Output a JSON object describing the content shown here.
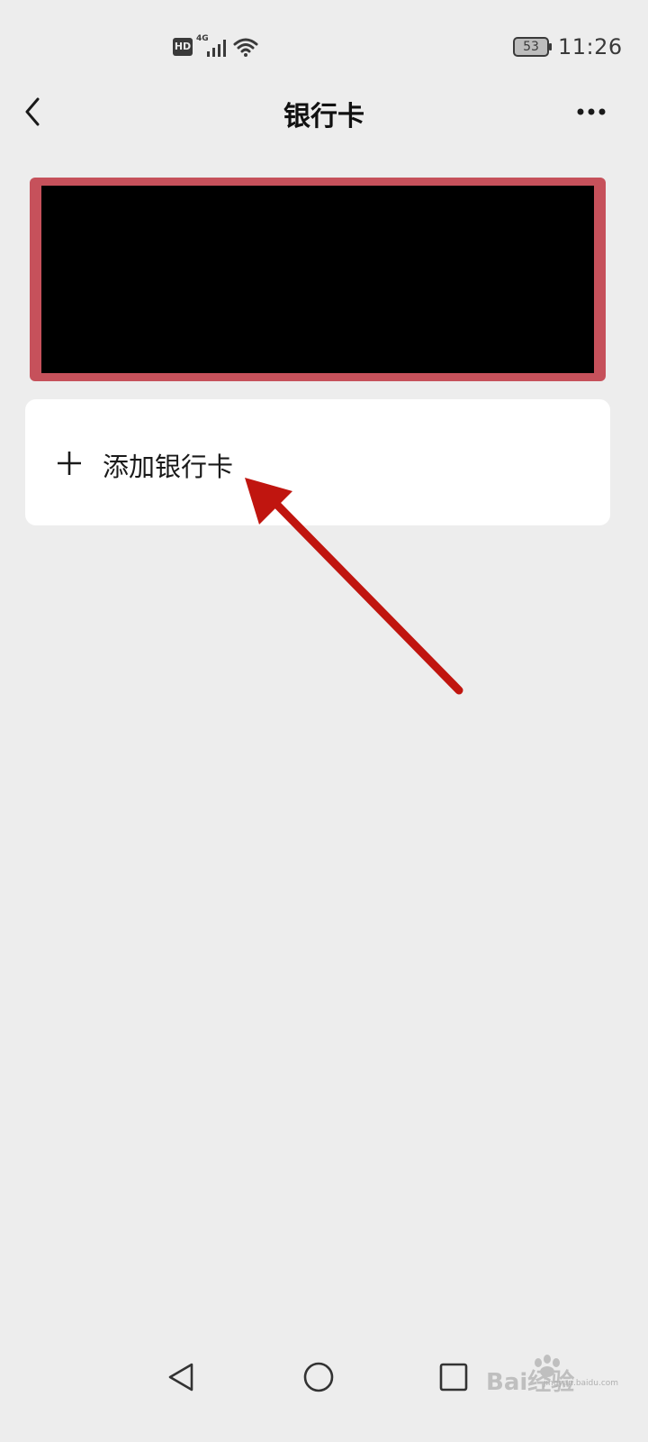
{
  "status_bar": {
    "hd": "HD",
    "network": "4G",
    "battery": "53",
    "time": "11:26"
  },
  "nav": {
    "title": "银行卡",
    "back_icon": "chevron-left-icon",
    "more_icon": "ellipsis-icon"
  },
  "card": {
    "accent_color": "#c6515b",
    "masked": true
  },
  "add_card": {
    "icon": "plus-icon",
    "label": "添加银行卡"
  },
  "annotation": {
    "arrow_color": "#c0150f"
  },
  "system_nav": {
    "back_icon": "triangle-back-icon",
    "home_icon": "circle-home-icon",
    "recents_icon": "square-recents-icon"
  },
  "watermark": {
    "text": "Bai经验",
    "subtext": "jingyan.baidu.com"
  }
}
